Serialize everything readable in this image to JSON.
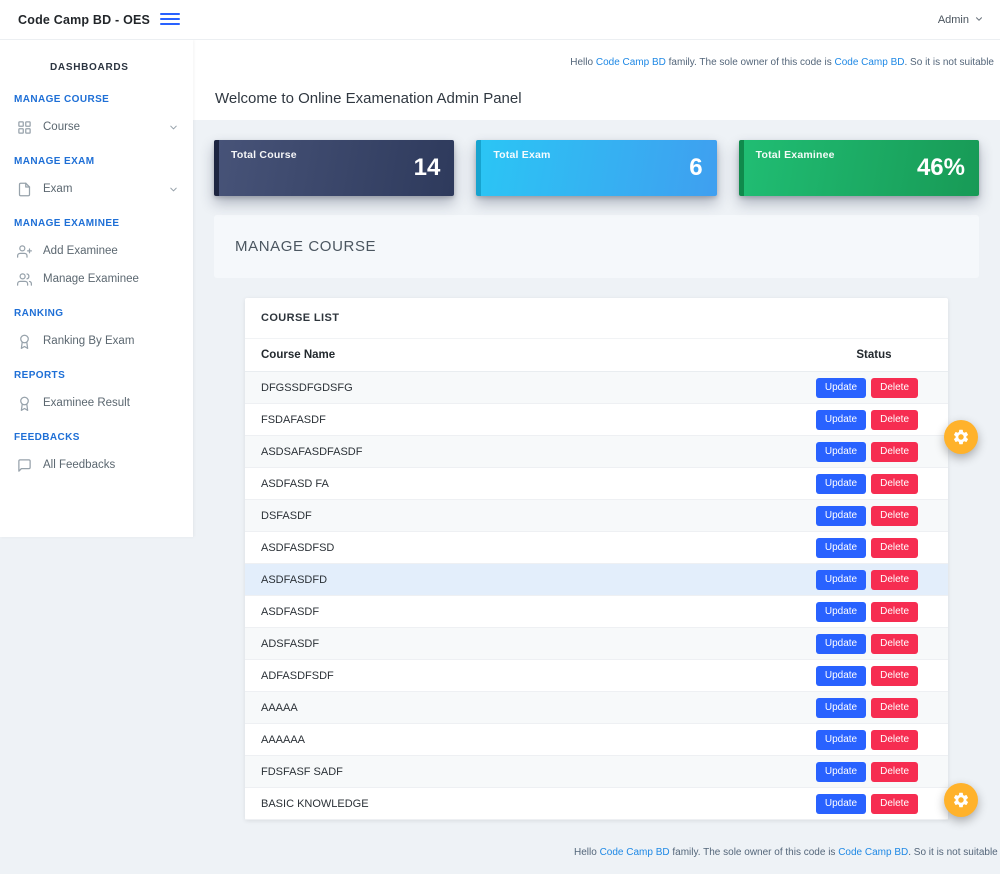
{
  "navbar": {
    "brand": "Code Camp BD - OES",
    "user_menu": "Admin"
  },
  "sidebar": {
    "items": [
      {
        "label": "DASHBOARDS"
      },
      {
        "label": "MANAGE COURSE"
      },
      {
        "label": "Course"
      },
      {
        "label": "MANAGE EXAM"
      },
      {
        "label": "Exam"
      },
      {
        "label": "MANAGE EXAMINEE"
      },
      {
        "label": "Add Examinee"
      },
      {
        "label": "Manage Examinee"
      },
      {
        "label": "RANKING"
      },
      {
        "label": "Ranking By Exam"
      },
      {
        "label": "REPORTS"
      },
      {
        "label": "Examinee Result"
      },
      {
        "label": "FEEDBACKS"
      },
      {
        "label": "All Feedbacks"
      }
    ]
  },
  "page": {
    "welcome_title": "Welcome to Online Examenation Admin Panel",
    "section_title": "MANAGE COURSE"
  },
  "notice": {
    "prefix": "Hello ",
    "brand_link": "Code Camp BD",
    "middle": " family. The sole owner of this code is ",
    "brand_link2": "Code Camp BD",
    "suffix_top": ". So it is not suitable",
    "suffix_bottom": ". So it is not suitable for ar"
  },
  "stats": {
    "cards": [
      {
        "label": "Total Course",
        "value": "14"
      },
      {
        "label": "Total Exam",
        "value": "6"
      },
      {
        "label": "Total Examinee",
        "value": "46%"
      }
    ]
  },
  "course_table": {
    "card_title": "COURSE LIST",
    "columns": [
      "Course Name",
      "Status"
    ],
    "update_label": "Update",
    "delete_label": "Delete",
    "rows": [
      {
        "name": "DFGSSDFGDSFG"
      },
      {
        "name": "FSDAFASDF"
      },
      {
        "name": "ASDSAFASDFASDF"
      },
      {
        "name": "ASDFASD FA"
      },
      {
        "name": "DSFASDF"
      },
      {
        "name": "ASDFASDFSD"
      },
      {
        "name": "ASDFASDFD",
        "highlighted": true
      },
      {
        "name": "ASDFASDF"
      },
      {
        "name": "ADSFASDF"
      },
      {
        "name": "ADFASDFSDF"
      },
      {
        "name": "AAAAA"
      },
      {
        "name": "AAAAAA"
      },
      {
        "name": "FDSFASF SADF"
      },
      {
        "name": "BASIC KNOWLEDGE"
      }
    ]
  },
  "colors": {
    "primary": "#2962ff",
    "danger": "#f62d51",
    "fab": "#ffb22b",
    "link": "#1e88e5",
    "caption": "#1e6fd6",
    "highlight": "#e3eefb",
    "c1from": "#475378",
    "c1to": "#2e3a5c",
    "c1edge": "#1d2540",
    "c2from": "#2bc5f4",
    "c2to": "#3f9ff0",
    "c2edge": "#17a3cf",
    "c3from": "#20bd73",
    "c3to": "#189a56",
    "c3edge": "#108a4c"
  }
}
